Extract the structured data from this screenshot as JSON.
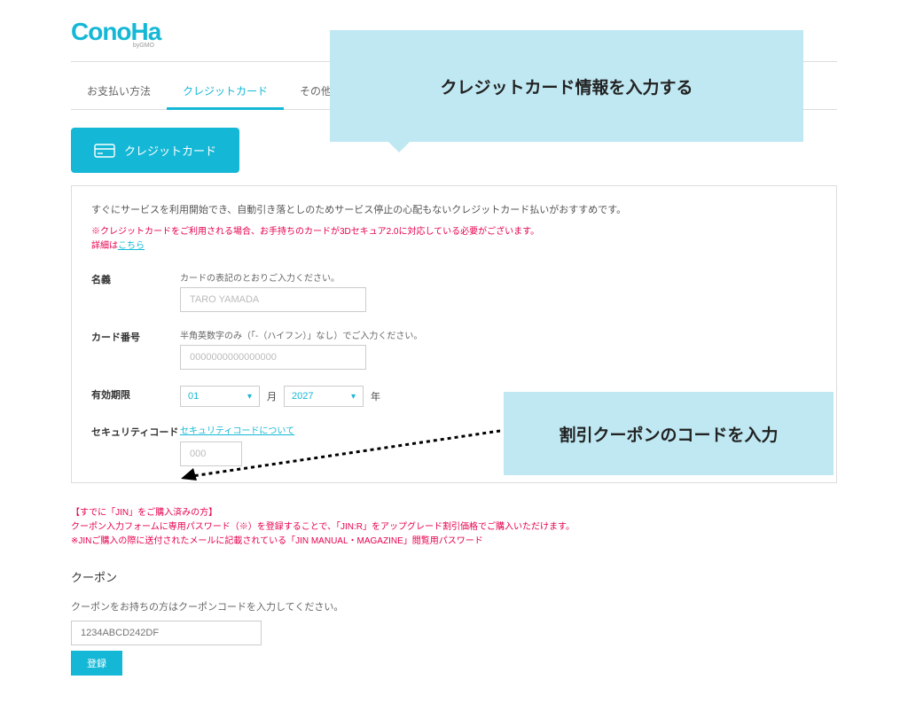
{
  "logo": {
    "main": "ConoHa",
    "sub": "byGMO"
  },
  "tabs": {
    "t0": "お支払い方法",
    "t1": "クレジットカード",
    "t2": "その他"
  },
  "cardbtn": {
    "label": "クレジットカード"
  },
  "panel": {
    "desc": "すぐにサービスを利用開始でき、自動引き落としのためサービス停止の心配もないクレジットカード払いがおすすめです。",
    "warn1": "※クレジットカードをご利用される場合、お手持ちのカードが3Dセキュア2.0に対応している必要がございます。",
    "warn2prefix": "詳細は",
    "warn2link": "こちら"
  },
  "form": {
    "name": {
      "label": "名義",
      "help": "カードの表記のとおりご入力ください。",
      "placeholder": "TARO YAMADA"
    },
    "number": {
      "label": "カード番号",
      "help": "半角英数字のみ（「-（ハイフン）」なし）でご入力ください。",
      "placeholder": "0000000000000000"
    },
    "expiry": {
      "label": "有効期限",
      "month": "01",
      "monthUnit": "月",
      "year": "2027",
      "yearUnit": "年"
    },
    "security": {
      "label": "セキュリティコード",
      "link": "セキュリティコードについて",
      "placeholder": "000"
    }
  },
  "notice": {
    "l1": "【すでに「JIN」をご購入済みの方】",
    "l2": "クーポン入力フォームに専用パスワード（※）を登録することで、「JIN:R」をアップグレード割引価格でご購入いただけます。",
    "l3": "※JINご購入の際に送付されたメールに記載されている「JIN MANUAL・MAGAZINE」閲覧用パスワード"
  },
  "coupon": {
    "title": "クーポン",
    "help": "クーポンをお持ちの方はクーポンコードを入力してください。",
    "placeholder": "1234ABCD242DF",
    "button": "登録"
  },
  "callout1": "クレジットカード情報を入力する",
  "callout2": "割引クーポンのコードを入力"
}
